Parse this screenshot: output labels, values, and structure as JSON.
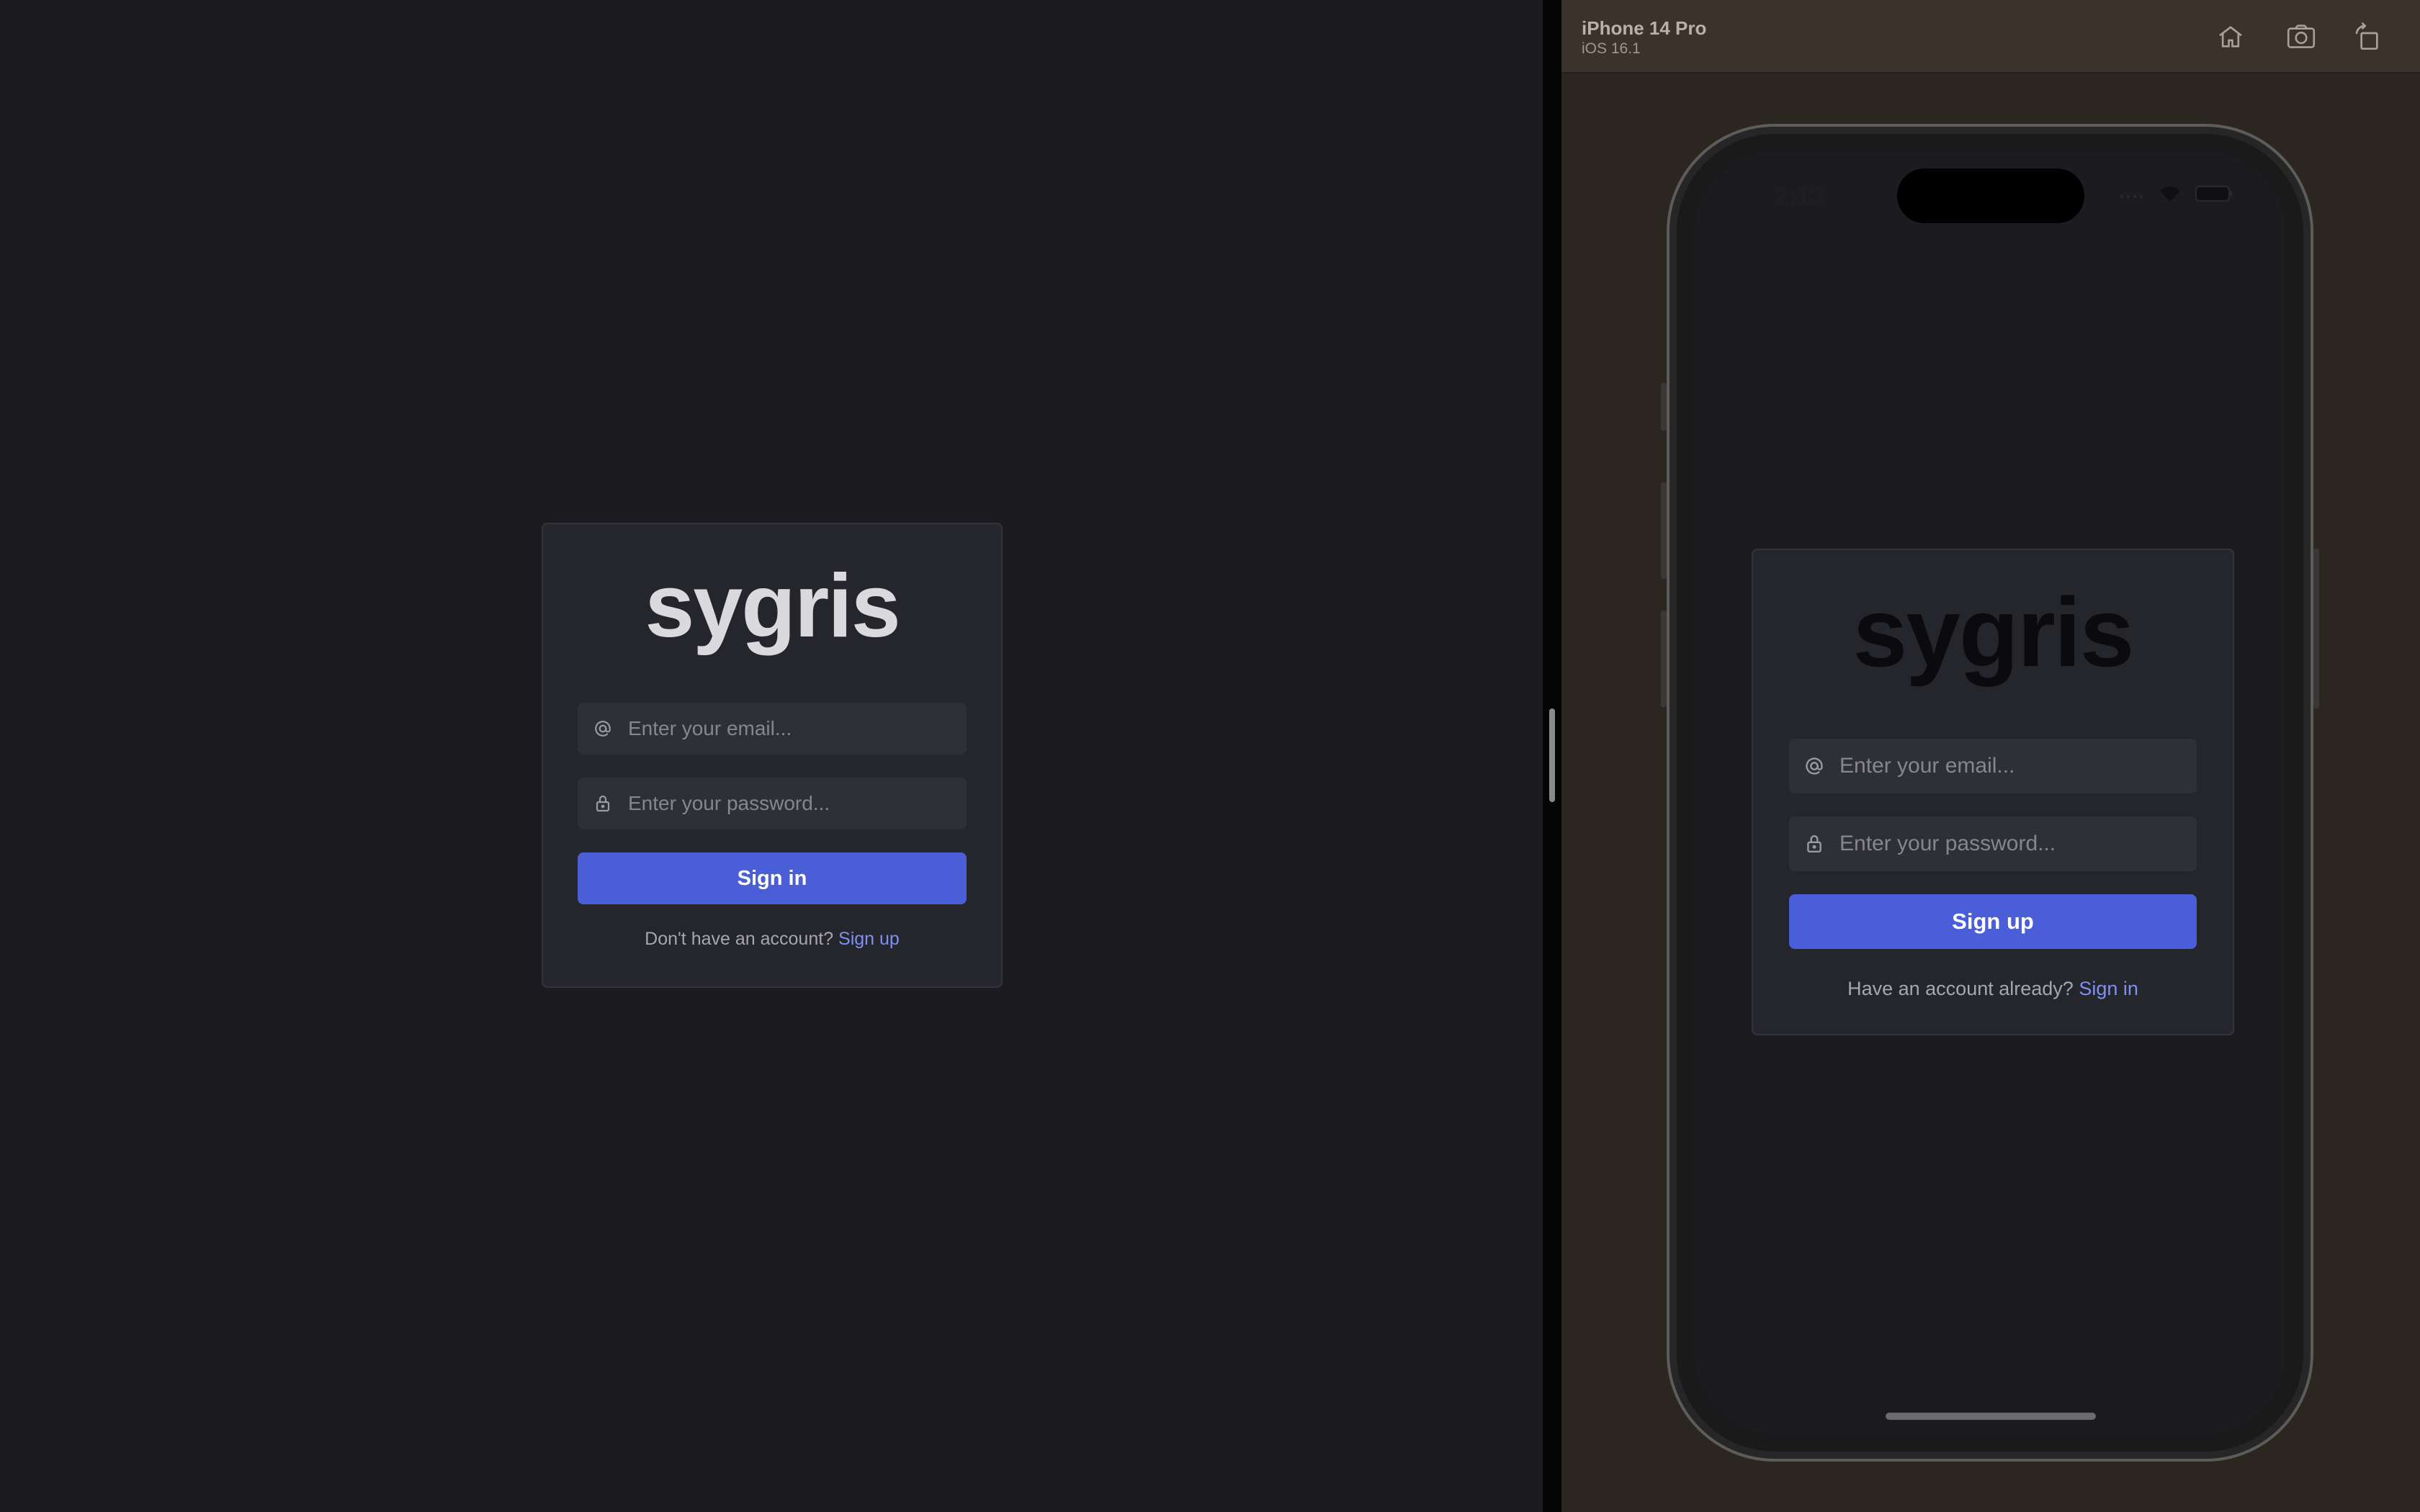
{
  "web": {
    "logo_text": "sygris",
    "email_placeholder": "Enter your email...",
    "password_placeholder": "Enter your password...",
    "submit_label": "Sign in",
    "footer_prompt": "Don't have an account?",
    "footer_link": "Sign up"
  },
  "simulator": {
    "device_name": "iPhone 14 Pro",
    "os_version": "iOS 16.1",
    "toolbar": [
      "home-icon",
      "screenshot-icon",
      "rotate-icon"
    ]
  },
  "phone": {
    "status_time": "2:13",
    "logo_text": "sygris",
    "email_placeholder": "Enter your email...",
    "password_placeholder": "Enter your password...",
    "submit_label": "Sign up",
    "footer_prompt": "Have an account already?",
    "footer_link": "Sign in"
  },
  "colors": {
    "background": "#1c1c20",
    "card": "#25262b",
    "input": "#2f3036",
    "primary": "#4a5ed8",
    "link": "#7e91f0",
    "simulator_bar": "#3b332b"
  }
}
